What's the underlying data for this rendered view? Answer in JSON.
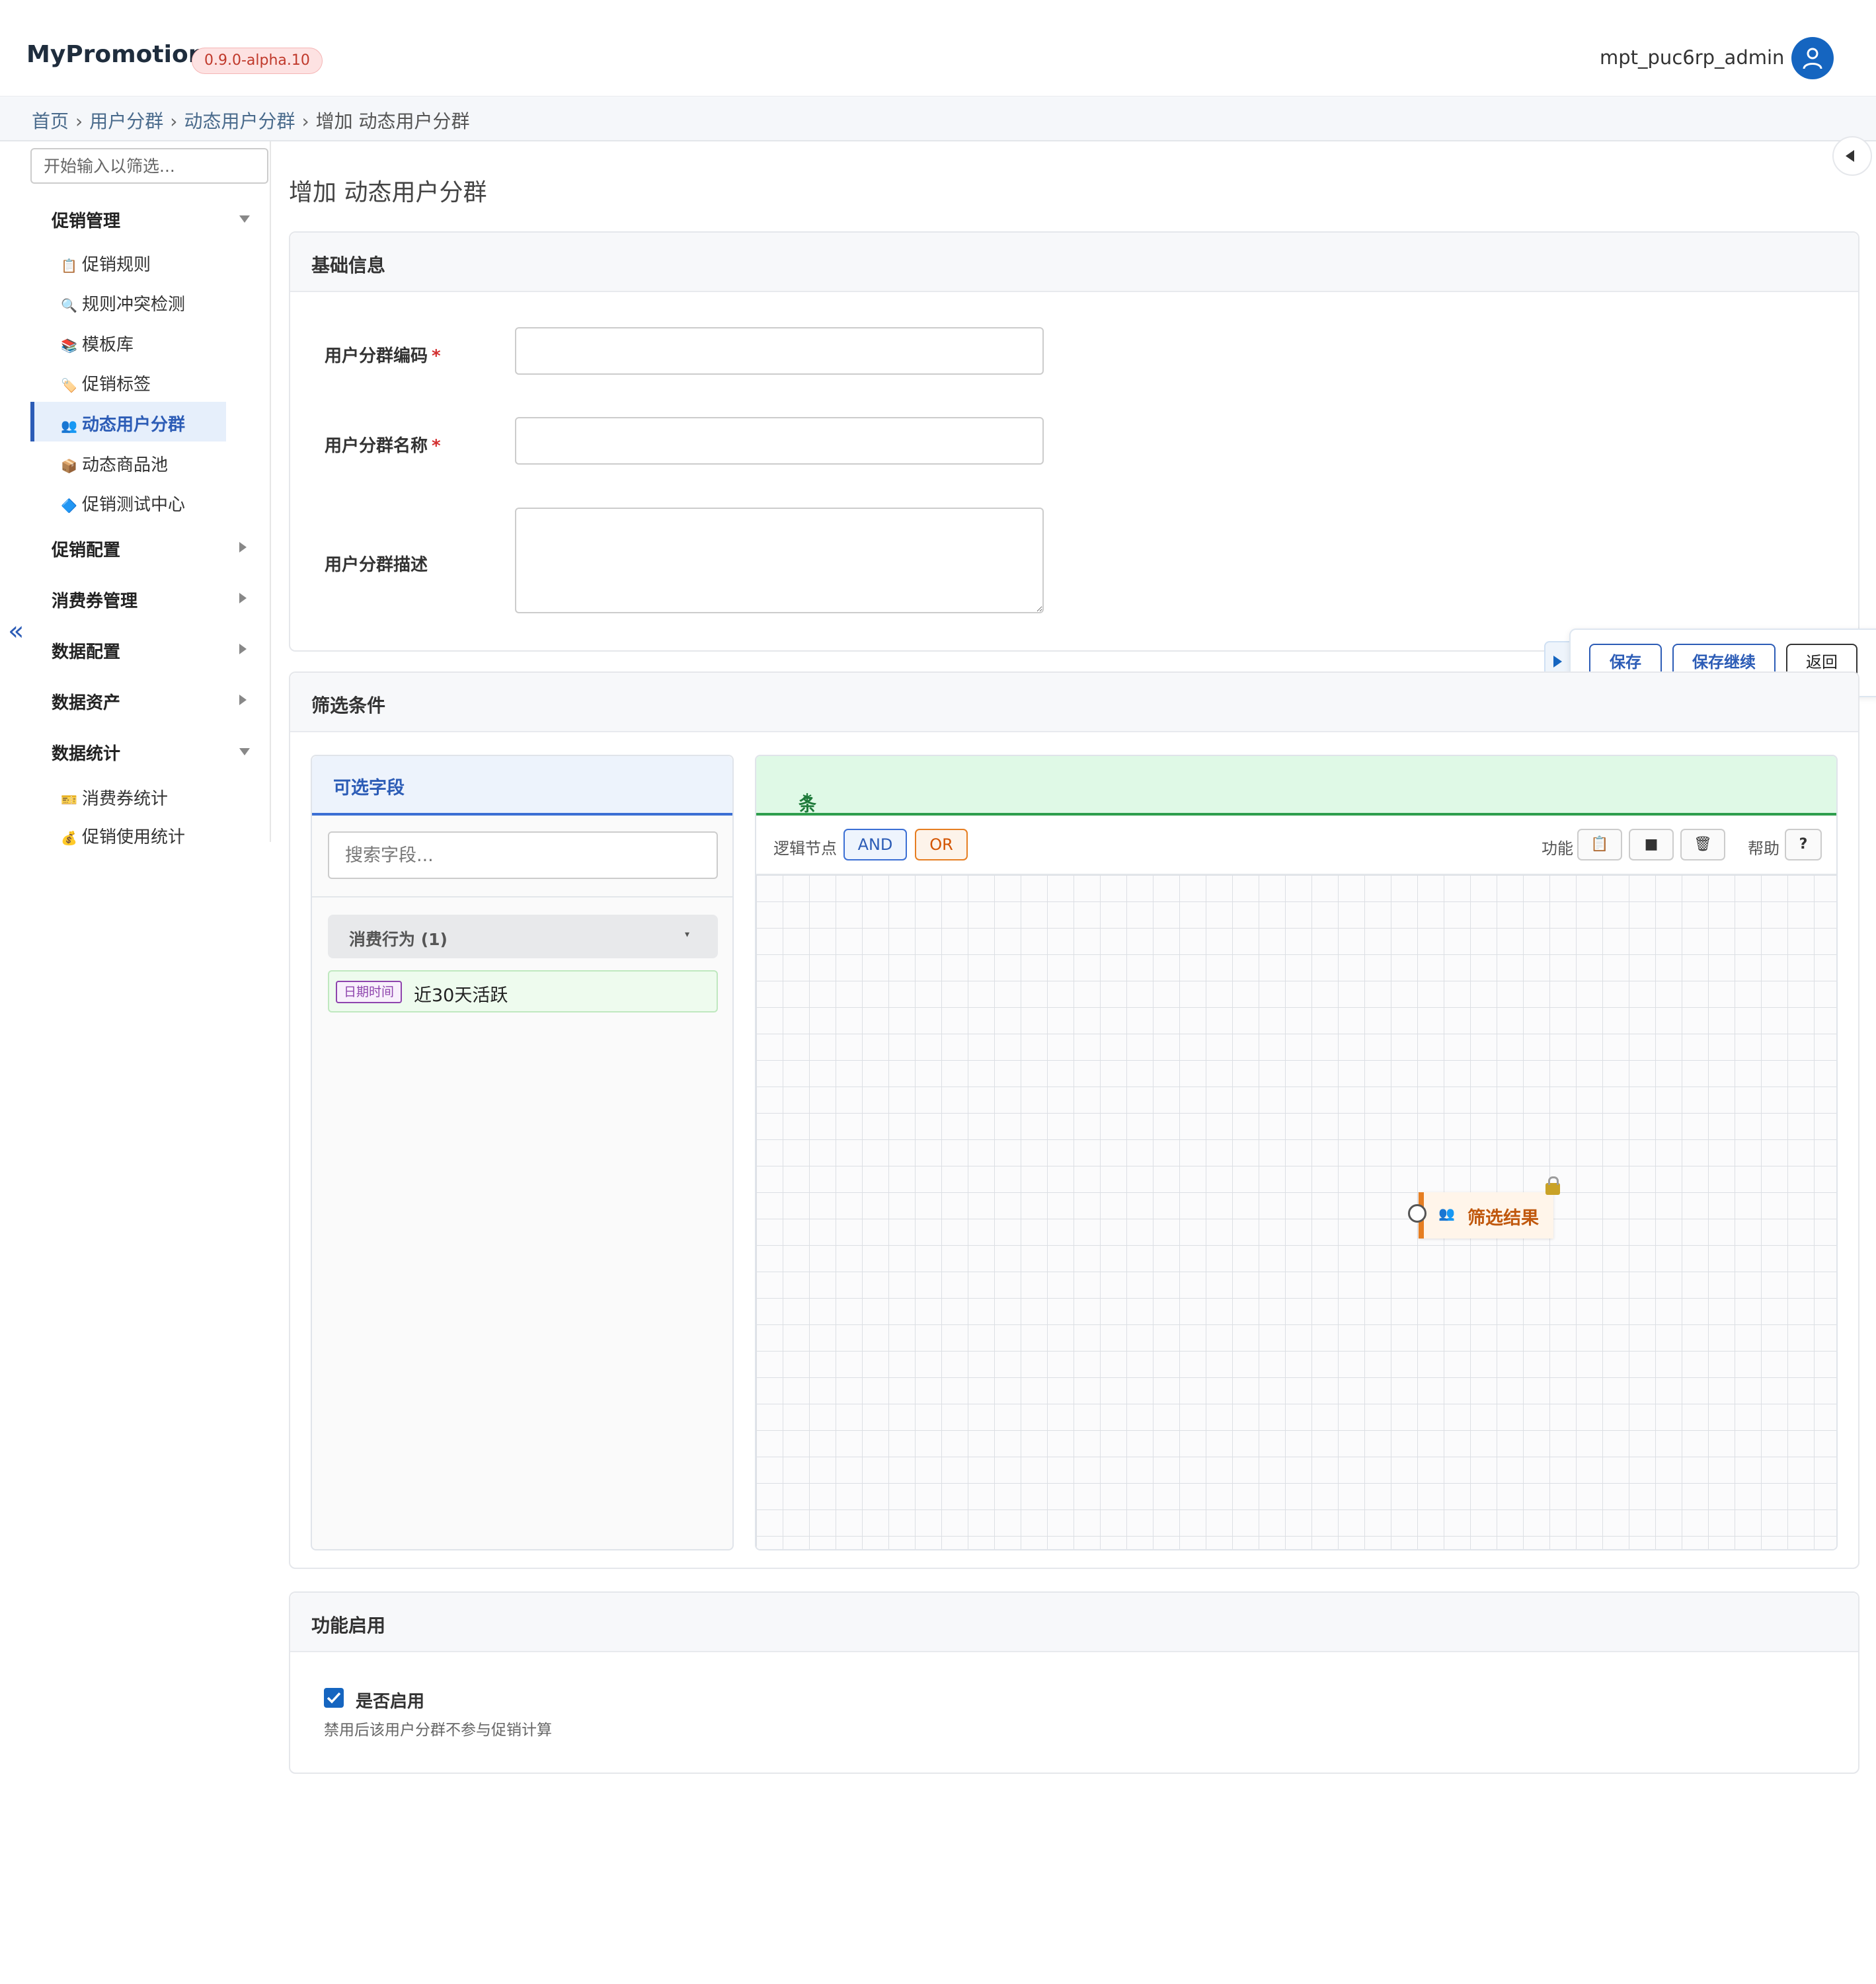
{
  "header": {
    "brand": "MyPromotion",
    "version": "0.9.0-alpha.10",
    "username": "mpt_puc6rp_admin",
    "avatar_icon": "user-icon"
  },
  "breadcrumb": {
    "items": [
      "首页",
      "用户分群",
      "动态用户分群",
      "增加 动态用户分群"
    ],
    "separator": "›"
  },
  "sidebar": {
    "filter_placeholder": "开始输入以筛选...",
    "sections": [
      {
        "label": "促销管理",
        "expanded": true,
        "items": [
          {
            "icon": "📋",
            "label": "促销规则"
          },
          {
            "icon": "🔍",
            "label": "规则冲突检测"
          },
          {
            "icon": "📚",
            "label": "模板库"
          },
          {
            "icon": "🏷️",
            "label": "促销标签"
          },
          {
            "icon": "👥",
            "label": "动态用户分群",
            "active": true
          },
          {
            "icon": "📦",
            "label": "动态商品池"
          },
          {
            "icon": "🔷",
            "label": "促销测试中心"
          }
        ]
      },
      {
        "label": "促销配置",
        "expanded": false
      },
      {
        "label": "消费券管理",
        "expanded": false
      },
      {
        "label": "数据配置",
        "expanded": false
      },
      {
        "label": "数据资产",
        "expanded": false
      },
      {
        "label": "数据统计",
        "expanded": true,
        "items": [
          {
            "icon": "🎫",
            "label": "消费券统计"
          },
          {
            "icon": "💰",
            "label": "促销使用统计"
          }
        ]
      }
    ],
    "collapse_glyph": "«"
  },
  "page": {
    "title": "增加 动态用户分群"
  },
  "basic": {
    "title": "基础信息",
    "code_label": "用户分群编码",
    "name_label": "用户分群名称",
    "desc_label": "用户分群描述",
    "required_mark": "*",
    "code_value": "",
    "name_value": "",
    "desc_value": ""
  },
  "actions": {
    "save": "保存",
    "save_continue": "保存继续",
    "back": "返回"
  },
  "filter": {
    "title": "筛选条件",
    "fields_panel": {
      "title": "可选字段",
      "search_placeholder": "搜索字段...",
      "group": {
        "label": "消费行为 (1)",
        "caret": "▾"
      },
      "field": {
        "tag": "日期时间",
        "label": "近30天活跃"
      }
    },
    "condition_panel": {
      "title": "条件配置",
      "required_mark": "*",
      "logic_label": "逻辑节点",
      "and": "AND",
      "or": "OR",
      "func_label": "功能",
      "func_icons": [
        "clipboard-icon",
        "stop-icon",
        "trash-icon"
      ],
      "func_glyphs": [
        "📋",
        "■",
        "🗑"
      ],
      "help_label": "帮助",
      "help_glyph": "?",
      "result_node": {
        "icon": "👥",
        "label": "筛选结果"
      }
    }
  },
  "enable": {
    "title": "功能启用",
    "checkbox_label": "是否启用",
    "checked": true,
    "hint": "禁用后该用户分群不参与促销计算"
  },
  "colors": {
    "accent": "#1565c0",
    "and": "#3b6fd4",
    "or": "#e67e22",
    "condition_header": "#dff9e6"
  }
}
